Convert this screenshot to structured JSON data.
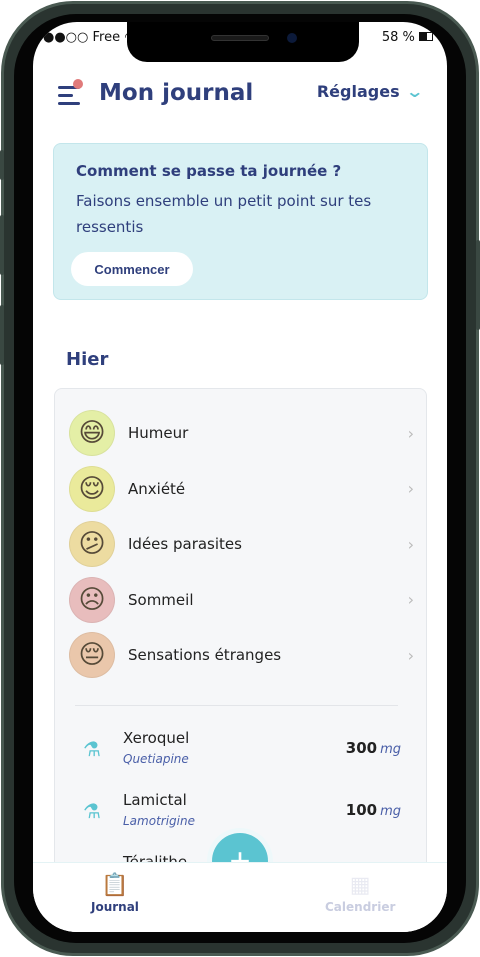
{
  "status": {
    "carrier": "Free",
    "battery": "58 %"
  },
  "header": {
    "title": "Mon journal",
    "settings_label": "Réglages"
  },
  "banner": {
    "title": "Comment se passe ta journée ?",
    "text": "Faisons ensemble un petit point sur tes ressentis",
    "button": "Commencer"
  },
  "section": {
    "title": "Hier"
  },
  "moods": [
    {
      "label": "Humeur",
      "icon": "laughing-face",
      "color": "#e3f28a"
    },
    {
      "label": "Anxiété",
      "icon": "content-face",
      "color": "#ecec7c"
    },
    {
      "label": "Idées parasites",
      "icon": "confused-face",
      "color": "#f4dc88"
    },
    {
      "label": "Sommeil",
      "icon": "sad-face",
      "color": "#f6b9b9"
    },
    {
      "label": "Sensations étranges",
      "icon": "weary-face",
      "color": "#f6c59c"
    }
  ],
  "meds": [
    {
      "name": "Xeroquel",
      "generic": "Quetiapine",
      "dose": "300",
      "unit": "mg"
    },
    {
      "name": "Lamictal",
      "generic": "Lamotrigine",
      "dose": "100",
      "unit": "mg"
    },
    {
      "name": "Téralithe"
    }
  ],
  "tabs": [
    {
      "label": "Journal",
      "active": true
    },
    {
      "label": "Calendrier",
      "active": false
    }
  ],
  "fab": "+",
  "colors": {
    "primary": "#2f3f7c",
    "accent": "#5bc4d1"
  }
}
